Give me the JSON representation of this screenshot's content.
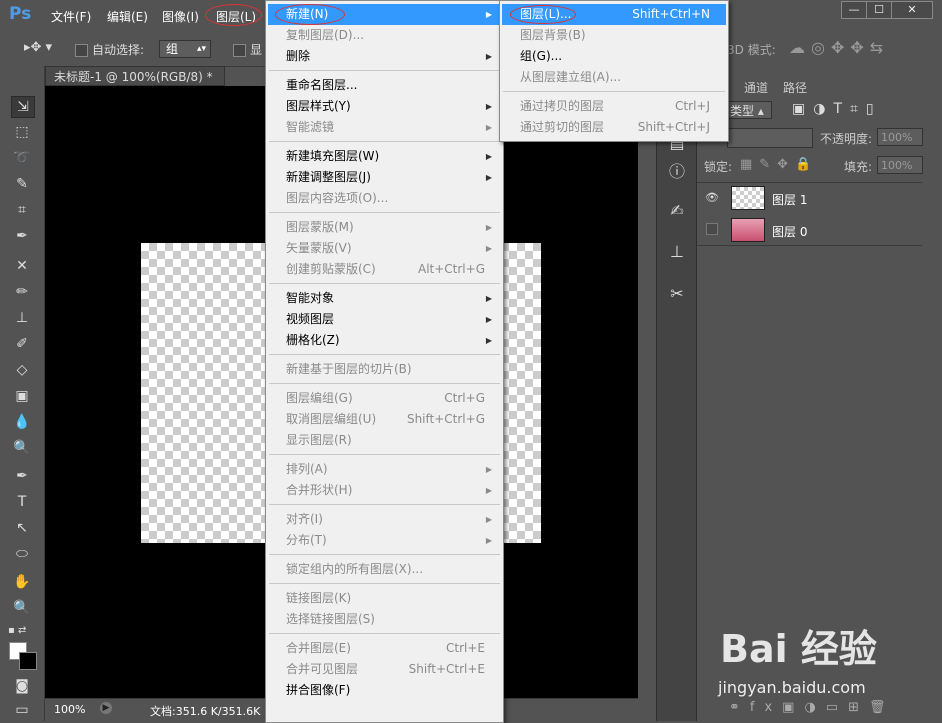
{
  "app": {
    "logo": "Ps"
  },
  "menubar": {
    "items": [
      "文件(F)",
      "编辑(E)",
      "图像(I)",
      "图层(L)"
    ]
  },
  "window_controls": {
    "minimize": "—",
    "maximize": "☐",
    "close": "✕"
  },
  "options_bar": {
    "auto_select_label": "自动选择:",
    "auto_select_value": "组",
    "show_label": "显",
    "mode_label": "3D 模式:"
  },
  "document": {
    "tab_title": "未标题-1 @ 100%(RGB/8) *",
    "tab_close": "×"
  },
  "status": {
    "zoom": "100%",
    "doc_info": "文档:351.6 K/351.6K"
  },
  "panels": {
    "tabs": [
      "通道",
      "路径"
    ],
    "filter_kind": "类型",
    "opacity_label": "不透明度:",
    "opacity_value": "100%",
    "lock_label": "锁定:",
    "fill_label": "填充:",
    "fill_value": "100%"
  },
  "layers": [
    {
      "name": "图层 1",
      "visible": true
    },
    {
      "name": "图层 0",
      "visible": false
    }
  ],
  "main_menu": {
    "items": [
      {
        "label": "新建(N)",
        "highlight": true,
        "submenu": true
      },
      {
        "label": "复制图层(D)...",
        "disabled": true
      },
      {
        "label": "删除",
        "submenu": true
      },
      {
        "sep": true
      },
      {
        "label": "重命名图层..."
      },
      {
        "label": "图层样式(Y)",
        "submenu": true
      },
      {
        "label": "智能滤镜",
        "disabled": true,
        "submenu": true
      },
      {
        "sep": true
      },
      {
        "label": "新建填充图层(W)",
        "submenu": true
      },
      {
        "label": "新建调整图层(J)",
        "submenu": true
      },
      {
        "label": "图层内容选项(O)...",
        "disabled": true
      },
      {
        "sep": true
      },
      {
        "label": "图层蒙版(M)",
        "disabled": true,
        "submenu": true
      },
      {
        "label": "矢量蒙版(V)",
        "disabled": true,
        "submenu": true
      },
      {
        "label": "创建剪贴蒙版(C)",
        "disabled": true,
        "shortcut": "Alt+Ctrl+G"
      },
      {
        "sep": true
      },
      {
        "label": "智能对象",
        "submenu": true
      },
      {
        "label": "视频图层",
        "submenu": true
      },
      {
        "label": "栅格化(Z)",
        "submenu": true
      },
      {
        "sep": true
      },
      {
        "label": "新建基于图层的切片(B)",
        "disabled": true
      },
      {
        "sep": true
      },
      {
        "label": "图层编组(G)",
        "disabled": true,
        "shortcut": "Ctrl+G"
      },
      {
        "label": "取消图层编组(U)",
        "disabled": true,
        "shortcut": "Shift+Ctrl+G"
      },
      {
        "label": "显示图层(R)",
        "disabled": true
      },
      {
        "sep": true
      },
      {
        "label": "排列(A)",
        "disabled": true,
        "submenu": true
      },
      {
        "label": "合并形状(H)",
        "disabled": true,
        "submenu": true
      },
      {
        "sep": true
      },
      {
        "label": "对齐(I)",
        "disabled": true,
        "submenu": true
      },
      {
        "label": "分布(T)",
        "disabled": true,
        "submenu": true
      },
      {
        "sep": true
      },
      {
        "label": "锁定组内的所有图层(X)...",
        "disabled": true
      },
      {
        "sep": true
      },
      {
        "label": "链接图层(K)",
        "disabled": true
      },
      {
        "label": "选择链接图层(S)",
        "disabled": true
      },
      {
        "sep": true
      },
      {
        "label": "合并图层(E)",
        "disabled": true,
        "shortcut": "Ctrl+E"
      },
      {
        "label": "合并可见图层",
        "disabled": true,
        "shortcut": "Shift+Ctrl+E"
      },
      {
        "label": "拼合图像(F)"
      }
    ]
  },
  "sub_menu": {
    "items": [
      {
        "label": "图层(L)...",
        "highlight": true,
        "shortcut": "Shift+Ctrl+N"
      },
      {
        "label": "图层背景(B)",
        "disabled": true
      },
      {
        "label": "组(G)..."
      },
      {
        "label": "从图层建立组(A)...",
        "disabled": true
      },
      {
        "sep": true
      },
      {
        "label": "通过拷贝的图层",
        "disabled": true,
        "shortcut": "Ctrl+J"
      },
      {
        "label": "通过剪切的图层",
        "disabled": true,
        "shortcut": "Shift+Ctrl+J"
      }
    ]
  },
  "watermark": {
    "brand": "Bai 经验",
    "url": "jingyan.baidu.com"
  }
}
